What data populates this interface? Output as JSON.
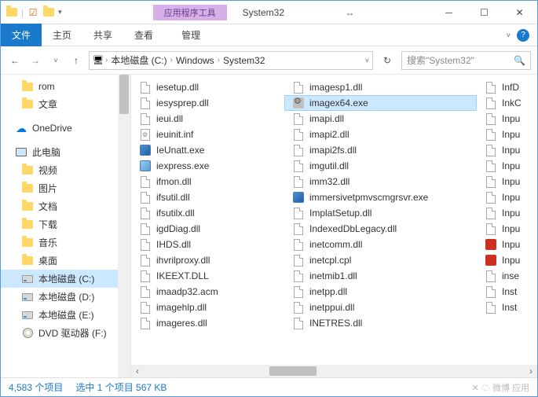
{
  "window": {
    "context_tab": "应用程序工具",
    "title": "System32",
    "qat_down": "▾"
  },
  "ribbon": {
    "file": "文件",
    "tabs": [
      "主页",
      "共享",
      "查看"
    ],
    "context_sub": "管理",
    "expand": "˅",
    "help": "?"
  },
  "nav": {
    "back": "←",
    "fwd": "→",
    "recent": "˅",
    "up": "↑",
    "pc_icon": "🖥",
    "chev": "›",
    "segments": [
      "本地磁盘 (C:)",
      "Windows",
      "System32"
    ],
    "dropdown": "˅",
    "refresh": "↻"
  },
  "search": {
    "placeholder": "搜索\"System32\"",
    "icon": "🔍"
  },
  "tree": {
    "rom": "rom",
    "docs": "文章",
    "onedrive": "OneDrive",
    "thispc": "此电脑",
    "videos": "视频",
    "pictures": "图片",
    "documents": "文档",
    "downloads": "下载",
    "music": "音乐",
    "desktop": "桌面",
    "drive_c": "本地磁盘 (C:)",
    "drive_d": "本地磁盘 (D:)",
    "drive_e": "本地磁盘 (E:)",
    "dvd": "DVD 驱动器 (F:)"
  },
  "files": {
    "col1": [
      {
        "n": "iesetup.dll",
        "t": "dll"
      },
      {
        "n": "iesysprep.dll",
        "t": "dll"
      },
      {
        "n": "ieui.dll",
        "t": "dll"
      },
      {
        "n": "ieuinit.inf",
        "t": "inf"
      },
      {
        "n": "IeUnatt.exe",
        "t": "exeblue"
      },
      {
        "n": "iexpress.exe",
        "t": "exe"
      },
      {
        "n": "ifmon.dll",
        "t": "dll"
      },
      {
        "n": "ifsutil.dll",
        "t": "dll"
      },
      {
        "n": "ifsutilx.dll",
        "t": "dll"
      },
      {
        "n": "igdDiag.dll",
        "t": "dll"
      },
      {
        "n": "IHDS.dll",
        "t": "dll"
      },
      {
        "n": "ihvrilproxy.dll",
        "t": "dll"
      },
      {
        "n": "IKEEXT.DLL",
        "t": "dll"
      },
      {
        "n": "imaadp32.acm",
        "t": "dll"
      },
      {
        "n": "imagehlp.dll",
        "t": "dll"
      },
      {
        "n": "imageres.dll",
        "t": "dll"
      }
    ],
    "col2": [
      {
        "n": "imagesp1.dll",
        "t": "dll"
      },
      {
        "n": "imagex64.exe",
        "t": "gear",
        "sel": true
      },
      {
        "n": "imapi.dll",
        "t": "dll"
      },
      {
        "n": "imapi2.dll",
        "t": "dll"
      },
      {
        "n": "imapi2fs.dll",
        "t": "dll"
      },
      {
        "n": "imgutil.dll",
        "t": "dll"
      },
      {
        "n": "imm32.dll",
        "t": "dll"
      },
      {
        "n": "immersivetpmvscmgrsvr.exe",
        "t": "exeblue"
      },
      {
        "n": "ImplatSetup.dll",
        "t": "dll"
      },
      {
        "n": "IndexedDbLegacy.dll",
        "t": "dll"
      },
      {
        "n": "inetcomm.dll",
        "t": "dll"
      },
      {
        "n": "inetcpl.cpl",
        "t": "dll"
      },
      {
        "n": "inetmib1.dll",
        "t": "dll"
      },
      {
        "n": "inetpp.dll",
        "t": "dll"
      },
      {
        "n": "inetppui.dll",
        "t": "dll"
      },
      {
        "n": "INETRES.dll",
        "t": "dll"
      }
    ],
    "col3": [
      {
        "n": "InfD",
        "t": "dll"
      },
      {
        "n": "InkC",
        "t": "dll"
      },
      {
        "n": "Inpu",
        "t": "dll"
      },
      {
        "n": "Inpu",
        "t": "dll"
      },
      {
        "n": "Inpu",
        "t": "dll"
      },
      {
        "n": "Inpu",
        "t": "dll"
      },
      {
        "n": "Inpu",
        "t": "dll"
      },
      {
        "n": "Inpu",
        "t": "dll"
      },
      {
        "n": "Inpu",
        "t": "dll"
      },
      {
        "n": "Inpu",
        "t": "dll"
      },
      {
        "n": "Inpu",
        "t": "red"
      },
      {
        "n": "Inpu",
        "t": "red"
      },
      {
        "n": "inse",
        "t": "dll"
      },
      {
        "n": "Inst",
        "t": "dll"
      },
      {
        "n": "Inst",
        "t": "dll"
      }
    ]
  },
  "status": {
    "count": "4,583 个项目",
    "selection": "选中 1 个项目  567 KB",
    "watermark": "✕ ☁ 微博 应用"
  }
}
